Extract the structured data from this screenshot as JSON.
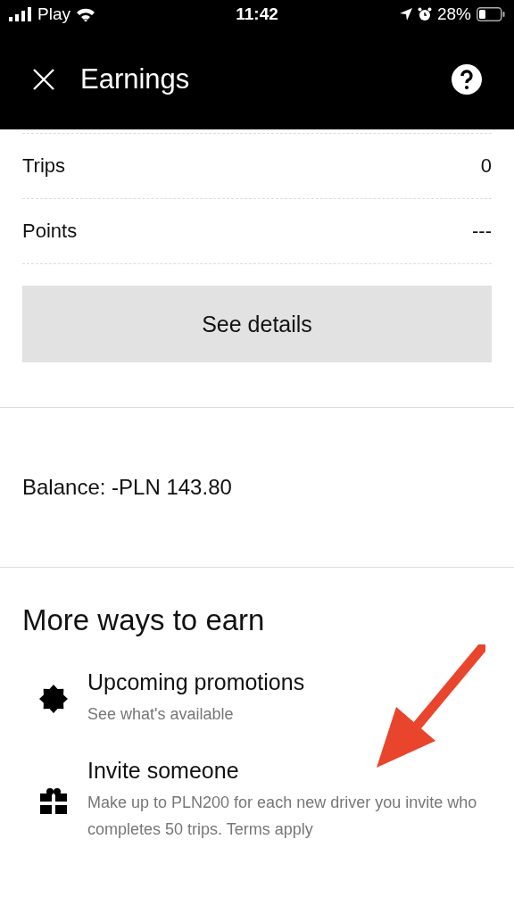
{
  "status_bar": {
    "carrier": "Play",
    "time": "11:42",
    "battery": "28%"
  },
  "header": {
    "title": "Earnings"
  },
  "stats": [
    {
      "label": "Trips",
      "value": "0"
    },
    {
      "label": "Points",
      "value": "---"
    }
  ],
  "details_button": "See details",
  "balance": "Balance: -PLN 143.80",
  "more_ways": {
    "heading": "More ways to earn",
    "items": [
      {
        "kind": "promotion",
        "title": "Upcoming promotions",
        "subtitle": "See what's available"
      },
      {
        "kind": "gift",
        "title": "Invite someone",
        "subtitle": "Make up to PLN200 for each new driver you invite who completes 50 trips. Terms apply"
      }
    ]
  },
  "annotations": [
    {
      "kind": "arrow"
    }
  ]
}
